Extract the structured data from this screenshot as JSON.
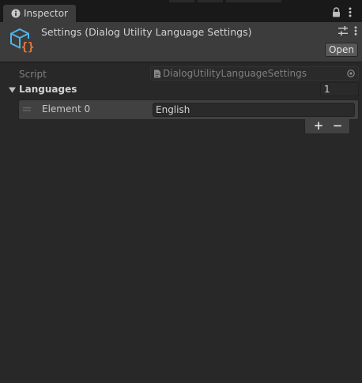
{
  "tab": {
    "label": "Inspector",
    "icon": "info-icon"
  },
  "header": {
    "title": "Settings (Dialog Utility Language Settings)",
    "open_label": "Open",
    "icon": "script-asset-icon"
  },
  "script_field": {
    "label": "Script",
    "value": "DialogUtilityLanguageSettings"
  },
  "languages": {
    "label": "Languages",
    "size": "1",
    "elements": [
      {
        "label": "Element 0",
        "value": "English"
      }
    ],
    "add_label": "+",
    "remove_label": "−"
  },
  "colors": {
    "background": "#282828",
    "header": "#3c3c3c",
    "tab_strip": "#191919",
    "text": "#d2d2d2",
    "muted_text": "#7f7f7f",
    "icon_blue": "#4fb3e6",
    "icon_orange": "#f07c3a"
  }
}
